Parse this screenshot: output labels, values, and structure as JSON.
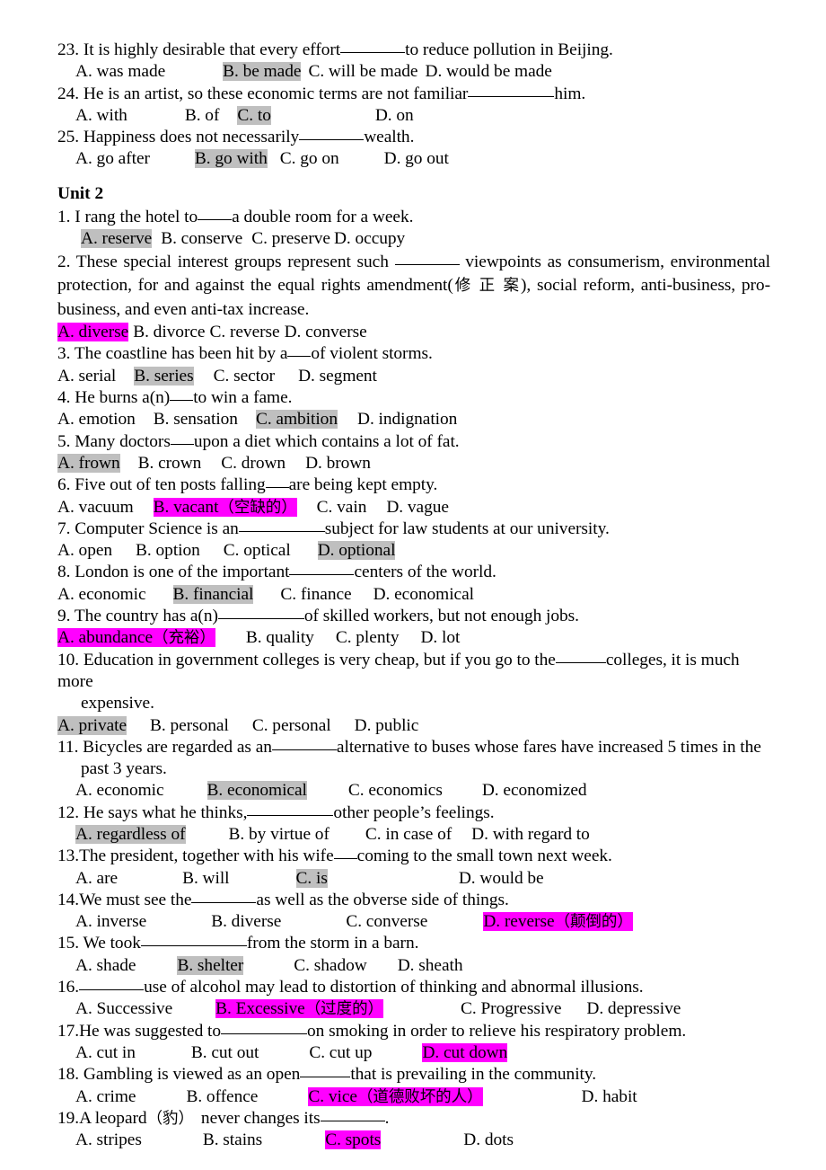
{
  "document": {
    "kind": "english-grammar-exercise-worksheet",
    "unit_heading": "Unit 2"
  },
  "colors": {
    "gray_highlight": "#bfbfbf",
    "magenta_highlight": "#ff00ff",
    "text": "#000000",
    "page_background": "#ffffff"
  },
  "questions": [
    {
      "number": "23.",
      "stem_before": "23. It is highly desirable that every effort",
      "stem_after": "to reduce pollution in Beijing.",
      "options": [
        {
          "label": "A. was made",
          "highlight": "none"
        },
        {
          "label": "B. be made",
          "highlight": "gray"
        },
        {
          "label": "C. will be made",
          "highlight": "none"
        },
        {
          "label": "D. would be made",
          "highlight": "none"
        }
      ]
    },
    {
      "number": "24.",
      "stem_before": "24. He is an artist, so these economic terms are not familiar",
      "stem_after": "him.",
      "options": [
        {
          "label": "A. with",
          "highlight": "none"
        },
        {
          "label": "B. of",
          "highlight": "none"
        },
        {
          "label": "C. to",
          "highlight": "gray"
        },
        {
          "label": "D. on",
          "highlight": "none"
        }
      ]
    },
    {
      "number": "25.",
      "stem_before": "25. Happiness does not necessarily",
      "stem_after": "wealth.",
      "options": [
        {
          "label": "A. go after",
          "highlight": "none"
        },
        {
          "label": "B. go with",
          "highlight": "gray"
        },
        {
          "label": "C. go on",
          "highlight": "none"
        },
        {
          "label": "D. go out",
          "highlight": "none"
        }
      ]
    },
    {
      "number": "1.",
      "stem_before": "1. I rang the hotel to",
      "stem_after": "a double room for   a week.",
      "options": [
        {
          "label": "A. reserve",
          "highlight": "gray"
        },
        {
          "label": "B. conserve",
          "highlight": "none"
        },
        {
          "label": "C. preserve",
          "highlight": "none"
        },
        {
          "label": "D. occupy",
          "highlight": "none"
        }
      ]
    },
    {
      "number": "2.",
      "stem_part1": "2.  These  special  interest  groups  represent  such",
      "stem_part2": "viewpoints  as  consumerism,  environmental protection,  for  and  against  the  equal  rights  amendment(",
      "stem_cjk": "修 正 案",
      "stem_part3": "),  social  reform,  anti-business, pro-business, and even anti-tax increase.",
      "options": [
        {
          "label": "A. diverse",
          "highlight": "magenta"
        },
        {
          "label": "B. divorce",
          "highlight": "none"
        },
        {
          "label": "C. reverse",
          "highlight": "none"
        },
        {
          "label": "D. converse",
          "highlight": "none"
        }
      ]
    },
    {
      "number": "3.",
      "stem_before": "3. The coastline has been hit by a",
      "stem_after": "of violent storms.",
      "options": [
        {
          "label": "A. serial",
          "highlight": "none"
        },
        {
          "label": "B. series",
          "highlight": "gray"
        },
        {
          "label": "C. sector",
          "highlight": "none"
        },
        {
          "label": "D. segment",
          "highlight": "none"
        }
      ]
    },
    {
      "number": "4.",
      "stem_before": "4.   He burns a(n)",
      "stem_after": "to win a fame.",
      "options": [
        {
          "label": "A. emotion",
          "highlight": "none"
        },
        {
          "label": "B. sensation",
          "highlight": "none"
        },
        {
          "label": "C. ambition",
          "highlight": "gray"
        },
        {
          "label": "D. indignation",
          "highlight": "none"
        }
      ]
    },
    {
      "number": "5.",
      "stem_before": "5. Many doctors",
      "stem_after": "upon a diet which contains a lot of fat.",
      "options": [
        {
          "label": "A. frown",
          "highlight": "gray"
        },
        {
          "label": "B. crown",
          "highlight": "none"
        },
        {
          "label": "C. drown",
          "highlight": "none"
        },
        {
          "label": "D. brown",
          "highlight": "none"
        }
      ]
    },
    {
      "number": "6.",
      "stem_before": "6. Five out of ten posts falling",
      "stem_after": "are being kept empty.",
      "options": [
        {
          "label": "A. vacuum",
          "highlight": "none"
        },
        {
          "label": "B. vacant",
          "gloss": "（空缺的）",
          "highlight": "magenta"
        },
        {
          "label": "C. vain",
          "highlight": "none"
        },
        {
          "label": "D. vague",
          "highlight": "none"
        }
      ]
    },
    {
      "number": "7.",
      "stem_before": "7. Computer Science is an",
      "stem_after": "subject for law students at our university.",
      "options": [
        {
          "label": "A. open",
          "highlight": "none"
        },
        {
          "label": "B. option",
          "highlight": "none"
        },
        {
          "label": "C. optical",
          "highlight": "none"
        },
        {
          "label": "D. optional",
          "highlight": "gray"
        }
      ]
    },
    {
      "number": "8.",
      "stem_before": "8. London is one of the important",
      "stem_after": "centers of the world.",
      "options": [
        {
          "label": "A. economic",
          "highlight": "none"
        },
        {
          "label": "B. financial",
          "highlight": "gray"
        },
        {
          "label": "C. finance",
          "highlight": "none"
        },
        {
          "label": "D. economical",
          "highlight": "none"
        }
      ]
    },
    {
      "number": "9.",
      "stem_before": "9. The country has a(n)",
      "stem_after": "of skilled workers, but not enough jobs.",
      "options": [
        {
          "label": "A. abundance",
          "gloss": "（充裕）",
          "highlight": "magenta"
        },
        {
          "label": "B. quality",
          "highlight": "none"
        },
        {
          "label": "C. plenty",
          "highlight": "none"
        },
        {
          "label": "D. lot",
          "highlight": "none"
        }
      ]
    },
    {
      "number": "10.",
      "stem_before": "10. Education in government colleges is very cheap, but if you go to the",
      "stem_after": "colleges, it is much more",
      "stem_line2": "expensive.",
      "options": [
        {
          "label": "A. private",
          "highlight": "gray"
        },
        {
          "label": "B. personal",
          "highlight": "none"
        },
        {
          "label": "C. personal",
          "highlight": "none"
        },
        {
          "label": "D. public",
          "highlight": "none"
        }
      ]
    },
    {
      "number": "11.",
      "stem_before": "11. Bicycles are regarded as an",
      "stem_after": "alternative to buses whose fares have increased 5 times in the",
      "stem_line2": "past 3 years.",
      "options": [
        {
          "label": "A. economic",
          "highlight": "none"
        },
        {
          "label": "B. economical",
          "highlight": "gray"
        },
        {
          "label": "C. economics",
          "highlight": "none"
        },
        {
          "label": "D. economized",
          "highlight": "none"
        }
      ]
    },
    {
      "number": "12.",
      "stem_before": "12. He says what he thinks,",
      "stem_after": "other people’s feelings.",
      "options": [
        {
          "label": "A. regardless of",
          "highlight": "gray"
        },
        {
          "label": "B. by virtue of",
          "highlight": "none"
        },
        {
          "label": "C. in case of",
          "highlight": "none"
        },
        {
          "label": "D. with regard to",
          "highlight": "none"
        }
      ]
    },
    {
      "number": "13.",
      "stem_before": "13.The president, together with his wife",
      "stem_after": "coming to the small town next week.",
      "options": [
        {
          "label": "A. are",
          "highlight": "none"
        },
        {
          "label": "B. will",
          "highlight": "none"
        },
        {
          "label": "C. is",
          "highlight": "gray"
        },
        {
          "label": "D. would be",
          "highlight": "none"
        }
      ]
    },
    {
      "number": "14.",
      "stem_before": "14.We must see the",
      "stem_after": "as well as the obverse side of things.",
      "options": [
        {
          "label": "A. inverse",
          "highlight": "none"
        },
        {
          "label": "B. diverse",
          "highlight": "none"
        },
        {
          "label": "C. converse",
          "highlight": "none"
        },
        {
          "label": "D. reverse",
          "gloss": "（颠倒的）",
          "highlight": "magenta"
        }
      ]
    },
    {
      "number": "15.",
      "stem_before": "15.  We took",
      "stem_after": "from the storm in a barn.",
      "options": [
        {
          "label": "A. shade",
          "highlight": "none"
        },
        {
          "label": "B. shelter",
          "highlight": "gray"
        },
        {
          "label": "C. shadow",
          "highlight": "none"
        },
        {
          "label": "D. sheath",
          "highlight": "none"
        }
      ]
    },
    {
      "number": "16.",
      "stem_before": "16.",
      "stem_after": "use of alcohol may lead to distortion of thinking and abnormal illusions.",
      "options": [
        {
          "label": "A. Successive",
          "highlight": "none"
        },
        {
          "label": "B. Excessive",
          "gloss": "（过度的）",
          "highlight": "magenta"
        },
        {
          "label": "C. Progressive",
          "highlight": "none"
        },
        {
          "label": "D. depressive",
          "highlight": "none"
        }
      ]
    },
    {
      "number": "17.",
      "stem_before": "17.He was suggested to",
      "stem_after": "on smoking in order to relieve his respiratory problem.",
      "options": [
        {
          "label": "A. cut in",
          "highlight": "none"
        },
        {
          "label": "B. cut out",
          "highlight": "none"
        },
        {
          "label": "C. cut up",
          "highlight": "none"
        },
        {
          "label": "D. cut down",
          "highlight": "magenta"
        }
      ]
    },
    {
      "number": "18.",
      "stem_before": "18. Gambling is viewed as an open",
      "stem_after": "that is prevailing in the community.",
      "options": [
        {
          "label": "A. crime",
          "highlight": "none"
        },
        {
          "label": "B. offence",
          "highlight": "none"
        },
        {
          "label": "C. vice",
          "gloss": "（道德败坏的人）",
          "highlight": "magenta"
        },
        {
          "label": "D. habit",
          "highlight": "none"
        }
      ]
    },
    {
      "number": "19.",
      "stem_before": "19.A leopard",
      "stem_cjk": "（豹）",
      "stem_mid": "never changes its",
      "stem_after": ".",
      "options": [
        {
          "label": "A. stripes",
          "highlight": "none"
        },
        {
          "label": "B. stains",
          "highlight": "none"
        },
        {
          "label": "C. spots",
          "highlight": "magenta"
        },
        {
          "label": "D. dots",
          "highlight": "none"
        }
      ]
    }
  ]
}
